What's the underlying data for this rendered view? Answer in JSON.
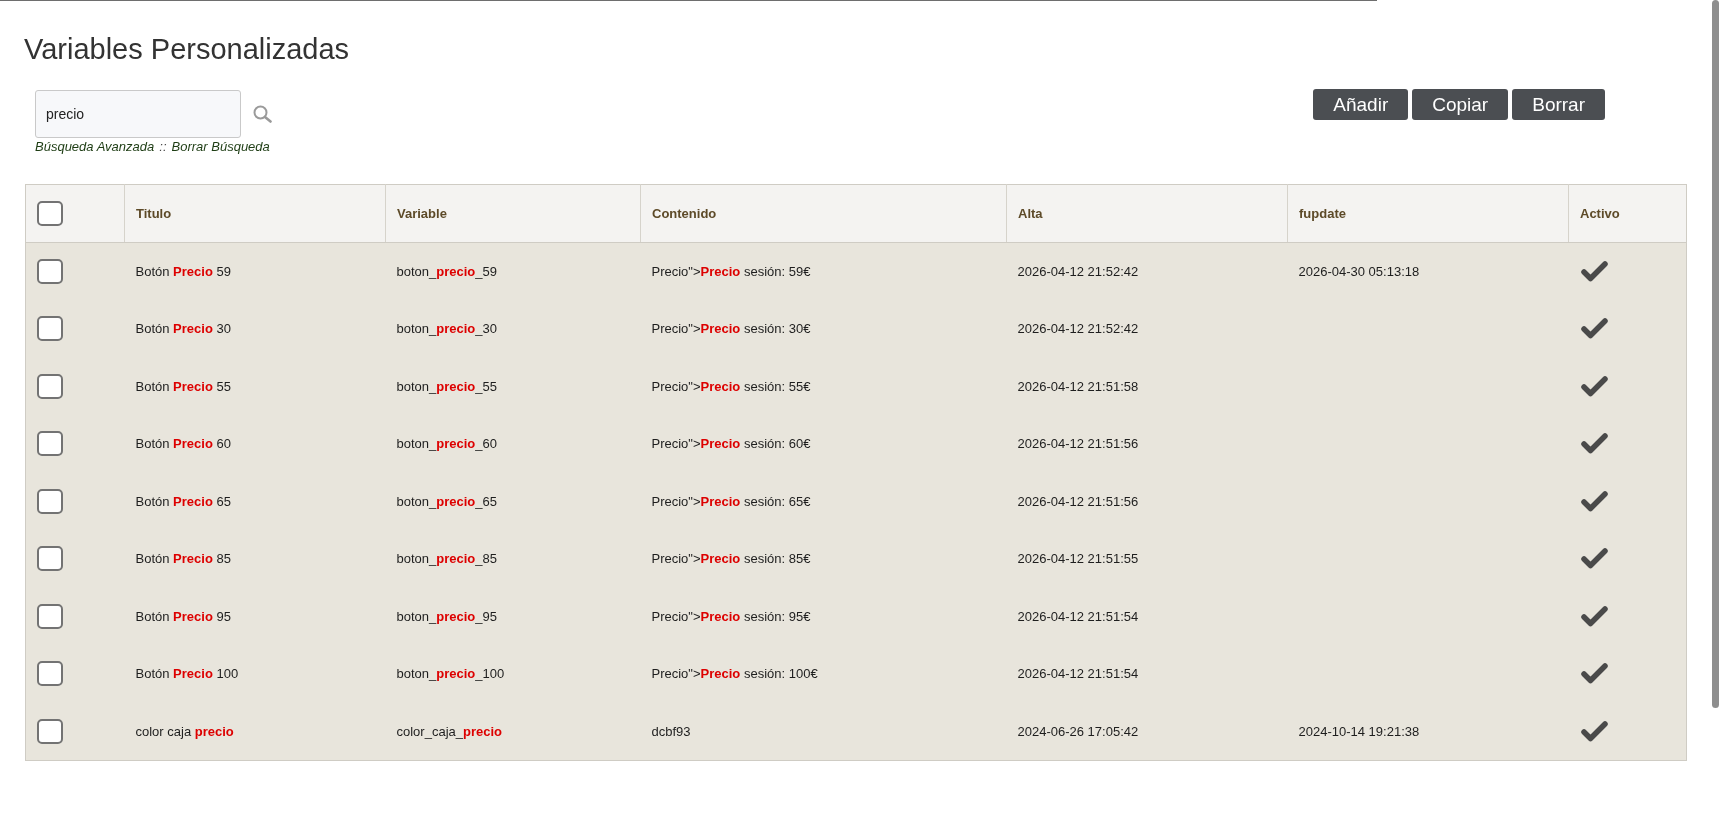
{
  "page": {
    "title": "Variables Personalizadas"
  },
  "search": {
    "value": "precio",
    "links": [
      {
        "kind": "link",
        "text": "Búsqueda Avanzada"
      },
      {
        "kind": "separator",
        "text": "::"
      },
      {
        "kind": "link",
        "text": "Borrar Búsqueda"
      }
    ]
  },
  "buttons": [
    "Añadir",
    "Copiar",
    "Borrar"
  ],
  "table": {
    "select_all": {
      "checked": false
    },
    "columns": [
      "Titulo",
      "Variable",
      "Contenido",
      "Alta",
      "fupdate",
      "Activo"
    ],
    "rows": [
      {
        "checked": false,
        "title": "Botón **Precio** 59",
        "variable": "boton_**precio**_59",
        "content": "Precio\">**Precio** sesión: 59€",
        "created": "2026-04-12 21:52:42",
        "updated": "2026-04-30 05:13:18",
        "active": true
      },
      {
        "checked": false,
        "title": "Botón **Precio** 30",
        "variable": "boton_**precio**_30",
        "content": "Precio\">**Precio** sesión: 30€",
        "created": "2026-04-12 21:52:42",
        "active": true
      },
      {
        "checked": false,
        "title": "Botón **Precio** 55",
        "variable": "boton_**precio**_55",
        "content": "Precio\">**Precio** sesión: 55€",
        "created": "2026-04-12 21:51:58",
        "active": true
      },
      {
        "checked": false,
        "title": "Botón **Precio** 60",
        "variable": "boton_**precio**_60",
        "content": "Precio\">**Precio** sesión: 60€",
        "created": "2026-04-12 21:51:56",
        "active": true
      },
      {
        "checked": false,
        "title": "Botón **Precio** 65",
        "variable": "boton_**precio**_65",
        "content": "Precio\">**Precio** sesión: 65€",
        "created": "2026-04-12 21:51:56",
        "active": true
      },
      {
        "checked": false,
        "title": "Botón **Precio** 85",
        "variable": "boton_**precio**_85",
        "content": "Precio\">**Precio** sesión: 85€",
        "created": "2026-04-12 21:51:55",
        "active": true
      },
      {
        "checked": false,
        "title": "Botón **Precio** 95",
        "variable": "boton_**precio**_95",
        "content": "Precio\">**Precio** sesión: 95€",
        "created": "2026-04-12 21:51:54",
        "active": true
      },
      {
        "checked": false,
        "title": "Botón **Precio** 100",
        "variable": "boton_**precio**_100",
        "content": "Precio\">**Precio** sesión: 100€",
        "created": "2026-04-12 21:51:54",
        "active": true
      },
      {
        "checked": false,
        "title": "color caja **precio**",
        "variable": "color_caja_**precio**",
        "content": "dcbf93",
        "created": "2024-06-26 17:05:42",
        "updated": "2024-10-14 19:21:38",
        "active": true
      }
    ]
  }
}
